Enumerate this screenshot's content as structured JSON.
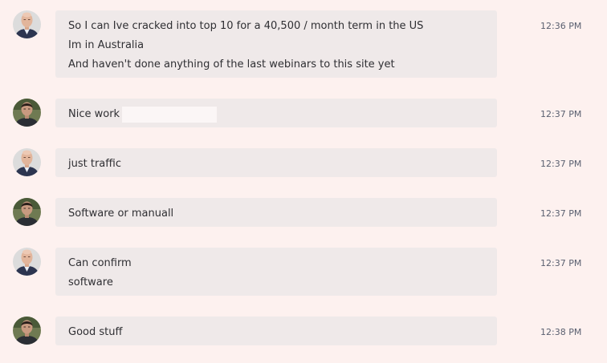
{
  "colors": {
    "page_background": "#fdf1ef",
    "bubble_background": "#efe9e9",
    "text": "#2f2f33",
    "timestamp": "#5a6070"
  },
  "messages": [
    {
      "avatar_icon": "bald-man-avatar-icon",
      "lines": [
        "So I can Ive cracked into top 10 for a 40,500 / month term in the US",
        "Im in Australia",
        "And haven't done anything of the last webinars to this site yet"
      ],
      "time": "12:36 PM"
    },
    {
      "avatar_icon": "dark-hair-man-avatar-icon",
      "lines": [
        "Nice work"
      ],
      "time": "12:37 PM"
    },
    {
      "avatar_icon": "bald-man-avatar-icon",
      "lines": [
        "just traffic"
      ],
      "time": "12:37 PM"
    },
    {
      "avatar_icon": "dark-hair-man-avatar-icon",
      "lines": [
        "Software or manuall"
      ],
      "time": "12:37 PM"
    },
    {
      "avatar_icon": "bald-man-avatar-icon",
      "lines": [
        "Can confirm",
        "software"
      ],
      "time": "12:37 PM"
    },
    {
      "avatar_icon": "dark-hair-man-avatar-icon",
      "lines": [
        "Good stuff"
      ],
      "time": "12:38 PM"
    }
  ]
}
